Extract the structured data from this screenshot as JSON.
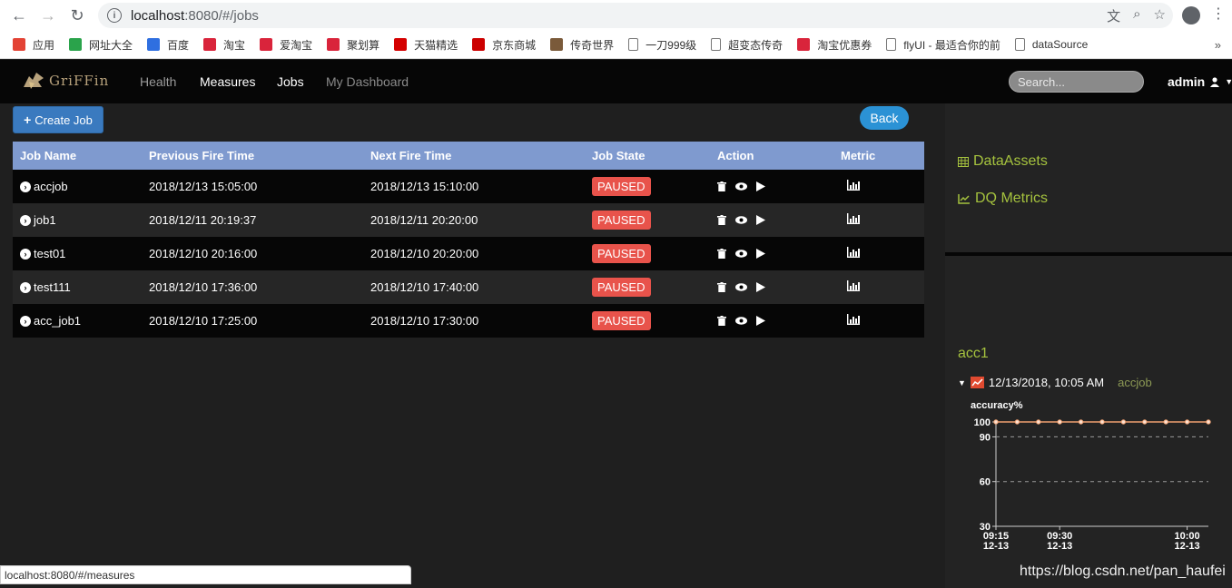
{
  "browser": {
    "url_host": "localhost",
    "url_rest": ":8080/#/jobs",
    "bookmarks": [
      {
        "label": "应用",
        "color": "#e34335"
      },
      {
        "label": "网址大全",
        "color": "#2aa34b"
      },
      {
        "label": "百度",
        "color": "#2f6fe0"
      },
      {
        "label": "淘宝",
        "color": "#d9243b"
      },
      {
        "label": "爱淘宝",
        "color": "#d9243b"
      },
      {
        "label": "聚划算",
        "color": "#d9243b"
      },
      {
        "label": "天猫精选",
        "color": "#d40000"
      },
      {
        "label": "京东商城",
        "color": "#cc0000"
      },
      {
        "label": "传奇世界",
        "color": "#7a5a3a"
      },
      {
        "label": "一刀999级",
        "color": "#ffffff"
      },
      {
        "label": "超变态传奇",
        "color": "#ffffff"
      },
      {
        "label": "淘宝优惠券",
        "color": "#d9243b"
      },
      {
        "label": "flyUI - 最适合你的前",
        "color": "#ffffff"
      },
      {
        "label": "dataSource",
        "color": "#ffffff"
      }
    ]
  },
  "nav": {
    "logo_text": "GriFFin",
    "links": {
      "health": "Health",
      "measures": "Measures",
      "jobs": "Jobs",
      "dashboard": "My Dashboard"
    },
    "search_placeholder": "Search...",
    "user": "admin"
  },
  "main": {
    "create_label": "Create Job",
    "back_label": "Back",
    "columns": [
      "Job Name",
      "Previous Fire Time",
      "Next Fire Time",
      "Job State",
      "Action",
      "Metric"
    ],
    "rows": [
      {
        "name": "accjob",
        "prev": "2018/12/13 15:05:00",
        "next": "2018/12/13 15:10:00",
        "state": "PAUSED"
      },
      {
        "name": "job1",
        "prev": "2018/12/11 20:19:37",
        "next": "2018/12/11 20:20:00",
        "state": "PAUSED"
      },
      {
        "name": "test01",
        "prev": "2018/12/10 20:16:00",
        "next": "2018/12/10 20:20:00",
        "state": "PAUSED"
      },
      {
        "name": "test111",
        "prev": "2018/12/10 17:36:00",
        "next": "2018/12/10 17:40:00",
        "state": "PAUSED"
      },
      {
        "name": "acc_job1",
        "prev": "2018/12/10 17:25:00",
        "next": "2018/12/10 17:30:00",
        "state": "PAUSED"
      }
    ]
  },
  "sidebar": {
    "data_assets": "DataAssets",
    "dq_metrics": "DQ Metrics",
    "measure_name": "acc1",
    "timestamp": "12/13/2018, 10:05 AM",
    "job_name": "accjob"
  },
  "chart_data": {
    "type": "line",
    "title": "accuracy%",
    "x_ticks": [
      {
        "time": "09:15",
        "date": "12-13"
      },
      {
        "time": "09:30",
        "date": "12-13"
      },
      {
        "time": "10:00",
        "date": "12-13"
      }
    ],
    "x_tick_minutes": [
      555,
      570,
      600
    ],
    "xlim_minutes": [
      555,
      605
    ],
    "y_ticks": [
      30,
      60,
      90,
      100
    ],
    "ylim": [
      30,
      100
    ],
    "series": [
      {
        "x_minutes": [
          555,
          560,
          565,
          570,
          575,
          580,
          585,
          590,
          595,
          600,
          605
        ],
        "values": [
          100,
          100,
          100,
          100,
          100,
          100,
          100,
          100,
          100,
          100,
          100
        ],
        "color": "#f0a070"
      }
    ],
    "grid_dashed_at": [
      90,
      60
    ]
  },
  "status_url": "localhost:8080/#/measures",
  "watermark": "https://blog.csdn.net/pan_haufei"
}
